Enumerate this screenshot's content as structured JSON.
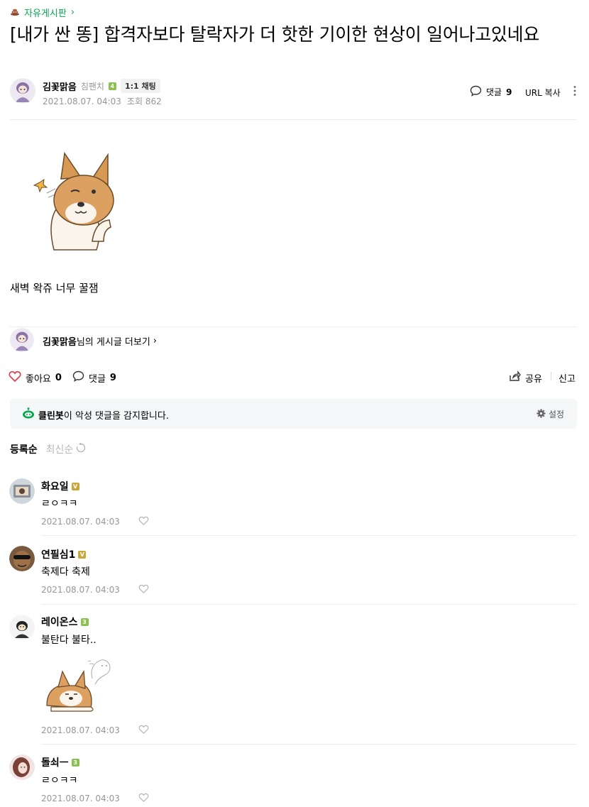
{
  "board": {
    "name": "자유게시판",
    "chevron": "›"
  },
  "post": {
    "title": "[내가 싼 똥] 합격자보다 탈락자가 더 핫한 기이한 현상이 일어나고있네요",
    "author": "김꽃맑음",
    "grade": "침팬치",
    "chat_label": "1:1 채팅",
    "date": "2021.08.07. 04:03",
    "views": "조회 862",
    "comment_label": "댓글",
    "comment_count": "9",
    "url_copy": "URL 복사",
    "body_text": "새벽 왁쥬 너무 꿀잼",
    "more_posts_author": "김꽃맑음",
    "more_posts_suffix": "님의 게시글 더보기",
    "more_chevron": "›"
  },
  "actions": {
    "like_label": "좋아요",
    "like_count": "0",
    "comment_label": "댓글",
    "comment_count": "9",
    "share_label": "공유",
    "report_label": "신고"
  },
  "cleanbot": {
    "name": "클린봇",
    "message": "이 악성 댓글을 감지합니다.",
    "settings_label": "설정"
  },
  "sort": {
    "registered": "등록순",
    "latest": "최신순"
  },
  "comments": [
    {
      "name": "화요일",
      "badge": "V",
      "text": "ㄹㅇㅋㅋ",
      "date": "2021.08.07. 04:03"
    },
    {
      "name": "연필심1",
      "badge": "V",
      "text": "축제다 축제",
      "date": "2021.08.07. 04:03"
    },
    {
      "name": "레이온스",
      "badge": "3",
      "text": "불탄다 불타..",
      "date": "2021.08.07. 04:03"
    },
    {
      "name": "돌쇠ㅡ",
      "badge": "3",
      "text": "ㄹㅇㅋㅋ",
      "date": "2021.08.07. 04:03"
    }
  ],
  "colors": {
    "accent": "#03a94d",
    "like": "#e6374b",
    "gold_badge": "#c9a53a",
    "green_badge": "#8cc152"
  }
}
